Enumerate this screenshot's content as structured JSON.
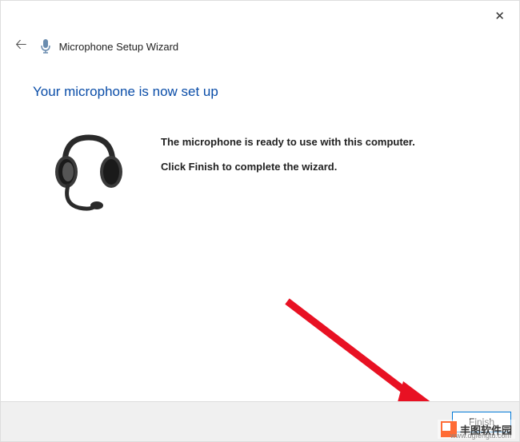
{
  "window": {
    "title": "Microphone Setup Wizard"
  },
  "content": {
    "heading": "Your microphone is now set up",
    "line1": "The microphone is ready to use with this computer.",
    "line2": "Click Finish to complete the wizard."
  },
  "footer": {
    "finish_label": "Finish"
  },
  "watermark": {
    "text": "丰图软件园",
    "url": "www.dgfengtu.com"
  }
}
